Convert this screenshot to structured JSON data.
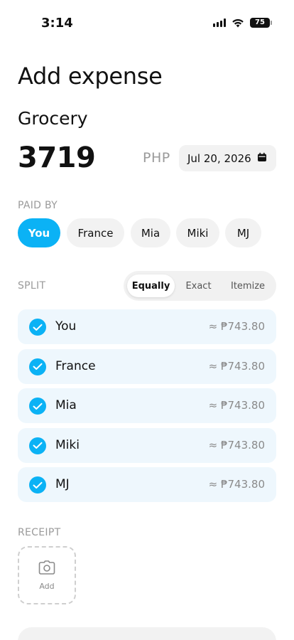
{
  "status_bar": {
    "time": "3:14",
    "battery": "75"
  },
  "page": {
    "title": "Add expense"
  },
  "expense": {
    "name": "Grocery",
    "amount": "3719",
    "currency": "PHP",
    "date": "Jul 20, 2026"
  },
  "paid_by": {
    "label": "PAID BY",
    "options": [
      "You",
      "France",
      "Mia",
      "Miki",
      "MJ"
    ],
    "selected": "You"
  },
  "split": {
    "label": "SPLIT",
    "modes": [
      "Equally",
      "Exact",
      "Itemize"
    ],
    "active_mode": "Equally",
    "rows": [
      {
        "name": "You",
        "amount": "≈ ₱743.80",
        "checked": true
      },
      {
        "name": "France",
        "amount": "≈ ₱743.80",
        "checked": true
      },
      {
        "name": "Mia",
        "amount": "≈ ₱743.80",
        "checked": true
      },
      {
        "name": "Miki",
        "amount": "≈ ₱743.80",
        "checked": true
      },
      {
        "name": "MJ",
        "amount": "≈ ₱743.80",
        "checked": true
      }
    ]
  },
  "receipt": {
    "label": "RECEIPT",
    "add_label": "Add"
  },
  "colors": {
    "accent": "#0bb2f5",
    "row_bg": "#eef7fd",
    "chip_bg": "#f2f2f2",
    "muted": "#9a9a9a"
  },
  "icons": {
    "date": "calendar-icon",
    "receipt": "camera-icon",
    "check": "check-icon"
  }
}
